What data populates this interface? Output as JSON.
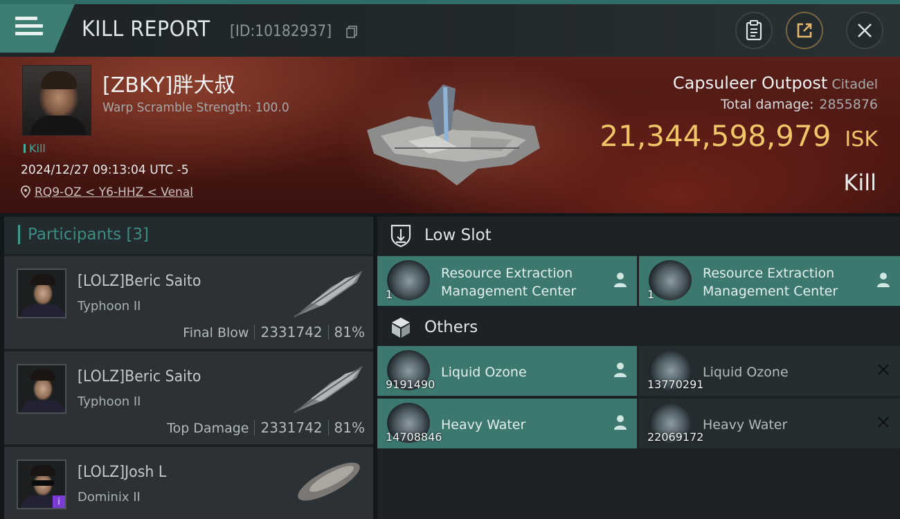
{
  "header": {
    "title": "KILL REPORT",
    "report_id": "[ID:10182937]"
  },
  "victim": {
    "name": "[ZBKY]胖大叔",
    "warp_scramble": "Warp Scramble Strength: 100.0",
    "kill_tag": "Kill",
    "datetime": "2024/12/27 09:13:04 UTC -5",
    "location": "RQ9-OZ < Y6-HHZ < Venal",
    "ship_name": "Capsuleer Outpost",
    "ship_class": "Citadel",
    "total_damage_label": "Total damage:",
    "total_damage": "2855876",
    "isk_value": "21,344,598,979",
    "isk_unit": "ISK",
    "result": "Kill"
  },
  "participants": {
    "label": "Participants",
    "count": "[3]",
    "items": [
      {
        "name": "[LOLZ]Beric Saito",
        "ship": "Typhoon II",
        "role": "Final Blow",
        "damage": "2331742",
        "percent": "81%"
      },
      {
        "name": "[LOLZ]Beric Saito",
        "ship": "Typhoon II",
        "role": "Top Damage",
        "damage": "2331742",
        "percent": "81%"
      },
      {
        "name": "[LOLZ]Josh L",
        "ship": "Dominix II",
        "badge": "i"
      }
    ]
  },
  "low_slot": {
    "label": "Low Slot",
    "items": [
      {
        "name_line1": "Resource Extraction",
        "name_line2": "Management Center",
        "qty": "1",
        "status": "dropped"
      },
      {
        "name_line1": "Resource Extraction",
        "name_line2": "Management Center",
        "qty": "1",
        "status": "dropped"
      }
    ]
  },
  "others": {
    "label": "Others",
    "items": [
      {
        "name": "Liquid Ozone",
        "qty": "9191490",
        "status": "dropped"
      },
      {
        "name": "Liquid Ozone",
        "qty": "13770291",
        "status": "destroyed"
      },
      {
        "name": "Heavy Water",
        "qty": "14708846",
        "status": "dropped"
      },
      {
        "name": "Heavy Water",
        "qty": "22069172",
        "status": "destroyed"
      }
    ]
  },
  "colors": {
    "accent_teal": "#3d7870",
    "isk_gold": "#f0c568",
    "banner_red": "#4a1712"
  }
}
